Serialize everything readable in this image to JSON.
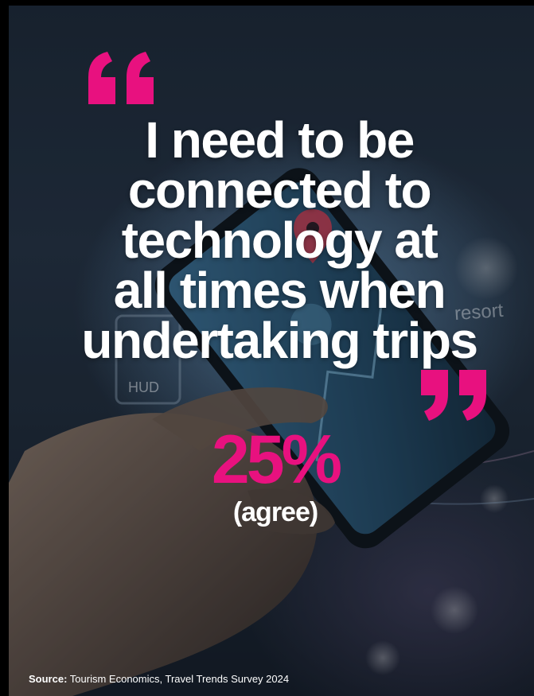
{
  "quote": {
    "lines": [
      "I need to be",
      "connected to",
      "technology at",
      "all times when",
      "undertaking trips"
    ]
  },
  "stat": {
    "value": "25%",
    "caption": "(agree)"
  },
  "source": {
    "label": "Source:",
    "text": "Tourism Economics, Travel Trends Survey 2024"
  },
  "background_labels": {
    "resort": "resort",
    "hud": "HUD"
  },
  "colors": {
    "accent": "#e8117f",
    "text": "#ffffff",
    "background": "#1f2a38"
  },
  "icons": {
    "open_quote": "left-double-quote-icon",
    "close_quote": "right-double-quote-icon",
    "location_pin": "map-pin-icon"
  }
}
